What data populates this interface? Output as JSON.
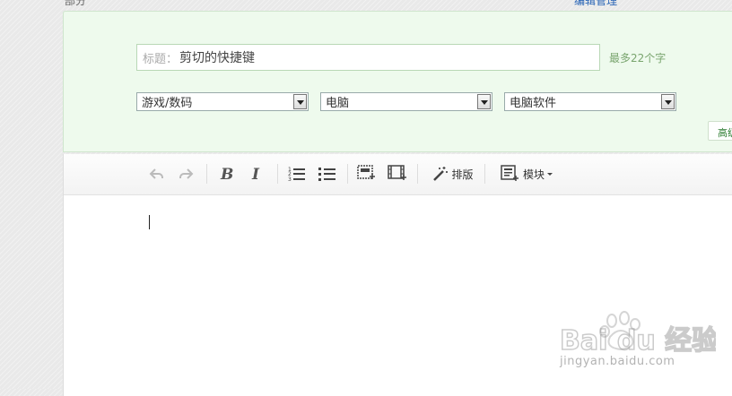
{
  "header": {
    "left_fragment": "部分",
    "right_fragment": "编辑管理"
  },
  "form": {
    "title_label": "标题：",
    "title_value": "剪切的快捷键",
    "limit_hint": "最多22个字",
    "category1": "游戏/数码",
    "category2": "电脑",
    "category3": "电脑软件",
    "advanced_label": "高级"
  },
  "toolbar": {
    "icons": {
      "undo": "undo-icon",
      "redo": "redo-icon",
      "bold": "bold-icon",
      "italic": "italic-icon",
      "ordered_list": "ordered-list-icon",
      "unordered_list": "unordered-list-icon",
      "insert_image": "insert-image-icon",
      "insert_video": "insert-video-icon",
      "format": "magic-wand-icon",
      "module": "module-icon"
    },
    "format_label": "排版",
    "module_label": "模块"
  },
  "watermark": {
    "logo_text": "Bai du 经验",
    "url_text": "jingyan.baidu.com"
  }
}
